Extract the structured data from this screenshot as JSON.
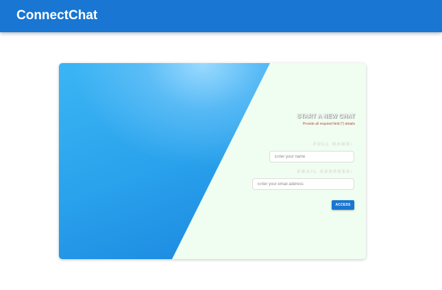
{
  "app": {
    "title": "ConnectChat",
    "brand_color": "#1976d2"
  },
  "login_card": {
    "title": "START A NEW CHAT",
    "subtitle": "Provide all required field (*) details",
    "fields": {
      "name": {
        "label": "FULL NAME:",
        "placeholder": "Enter your name",
        "value": ""
      },
      "email": {
        "label": "EMAIL ADDRESS:",
        "placeholder": "Enter your email address",
        "value": ""
      }
    },
    "submit_label": "ACCESS",
    "colors": {
      "panel_background": "#effef0",
      "hero_gradient_start": "#3cb5f4",
      "hero_gradient_end": "#1a82dc",
      "subtitle_color": "#b34a4a"
    }
  }
}
